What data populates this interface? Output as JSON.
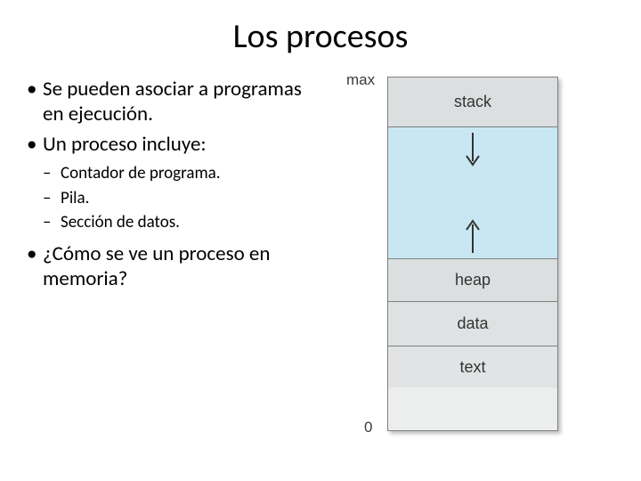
{
  "title": "Los procesos",
  "bullets": {
    "b1": "Se pueden asociar a programas en ejecución.",
    "b2": "Un proceso incluye:",
    "sub": {
      "s1": "Contador de programa.",
      "s2": "Pila.",
      "s3": "Sección de datos."
    },
    "b3": "¿Cómo se ve un proceso en memoria?"
  },
  "diagram": {
    "max": "max",
    "zero": "0",
    "segments": {
      "stack": "stack",
      "heap": "heap",
      "data": "data",
      "text": "text"
    }
  }
}
